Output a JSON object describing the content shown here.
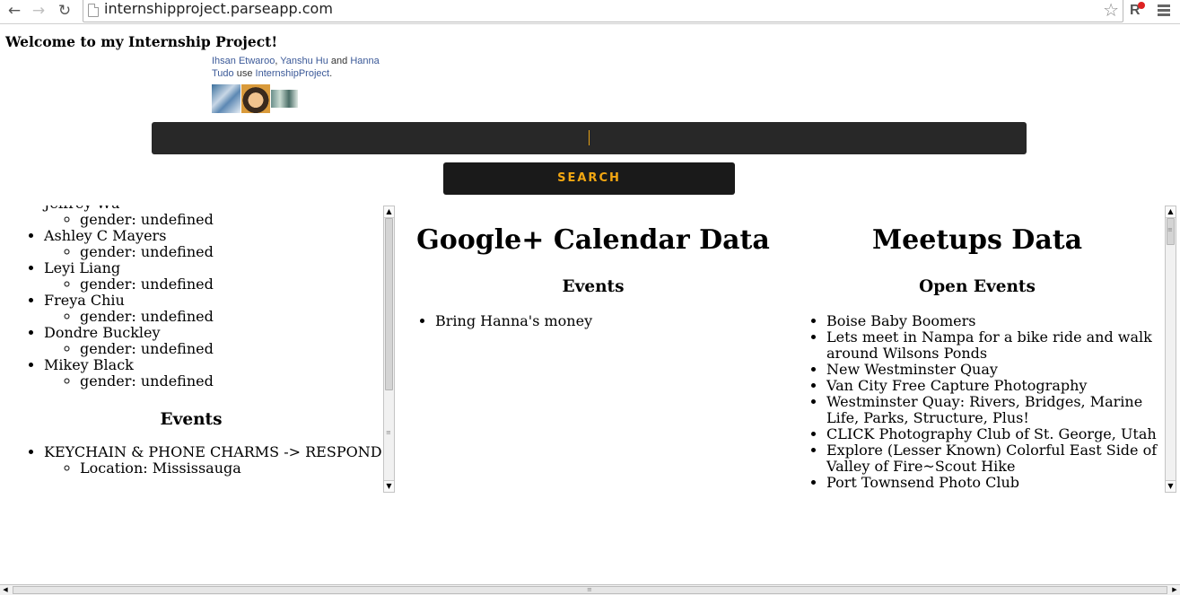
{
  "browser": {
    "url": "internshipproject.parseapp.com",
    "back_icon": "←",
    "forward_icon": "→",
    "reload_icon": "↻",
    "star_icon": "☆",
    "extension_letter": "R"
  },
  "page": {
    "title": "Welcome to my Internship Project!"
  },
  "facepile": {
    "user1": "Ihsan Etwaroo",
    "sep1": ", ",
    "user2": "Yanshu Hu",
    "and": " and ",
    "user3": "Hanna Tudo",
    "use": " use ",
    "app": "InternshipProject",
    "end": "."
  },
  "search": {
    "input_value": "",
    "button_label": "SEARCH"
  },
  "friends": [
    {
      "name": "Jeffrey Wu",
      "detail": "gender: undefined"
    },
    {
      "name": "Ashley C Mayers",
      "detail": "gender: undefined"
    },
    {
      "name": "Leyi Liang",
      "detail": "gender: undefined"
    },
    {
      "name": "Freya Chiu",
      "detail": "gender: undefined"
    },
    {
      "name": "Dondre Buckley",
      "detail": "gender: undefined"
    },
    {
      "name": "Mikey Black",
      "detail": "gender: undefined"
    }
  ],
  "left_events": {
    "heading": "Events",
    "items": [
      {
        "name": "KEYCHAIN & PHONE CHARMS -> RESPONDED",
        "detail": "Location: Mississauga"
      }
    ]
  },
  "google_calendar": {
    "heading": "Google+ Calendar Data",
    "subheading": "Events",
    "items": [
      "Bring Hanna's money"
    ]
  },
  "meetups": {
    "heading": "Meetups Data",
    "subheading": "Open Events",
    "items": [
      "Boise Baby Boomers",
      "Lets meet in Nampa for a bike ride and walk around Wilsons Ponds",
      "New Westminster Quay",
      "Van City Free Capture Photography",
      "Westminster Quay: Rivers, Bridges, Marine Life, Parks, Structure, Plus!",
      "CLICK Photography Club of St. George, Utah",
      "Explore (Lesser Known) Colorful East Side of Valley of Fire~Scout Hike",
      "Port Townsend Photo Club"
    ]
  },
  "scrollbar": {
    "up_arrow": "▲",
    "down_arrow": "▼",
    "left_arrow": "◀",
    "right_arrow": "▶",
    "grip": "≡"
  }
}
